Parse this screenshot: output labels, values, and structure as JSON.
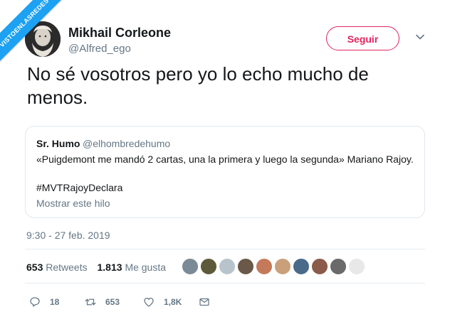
{
  "watermark": "VISTOENLASREDES",
  "author": {
    "name": "Mikhail Corleone",
    "handle": "@Alfred_ego"
  },
  "follow_label": "Seguir",
  "tweet_text": "No sé vosotros pero yo lo echo mucho de menos.",
  "quoted": {
    "name": "Sr. Humo",
    "handle": "@elhombredehumo",
    "text": "«Puigdemont me mandó 2 cartas, una la primera y luego la segunda» Mariano Rajoy.",
    "hashtag": "#MVTRajoyDeclara",
    "thread_link": "Mostrar este hilo"
  },
  "timestamp": "9:30 - 27 feb. 2019",
  "stats": {
    "retweets_count": "653",
    "retweets_label": "Retweets",
    "likes_count": "1.813",
    "likes_label": "Me gusta"
  },
  "likers_colors": [
    "#7a8a96",
    "#5d5a3a",
    "#b8c4cc",
    "#6a5848",
    "#c47a5a",
    "#c9a07a",
    "#4a6a8a",
    "#8a5a4a",
    "#6a6a6a",
    "#e8e8e8"
  ],
  "actions": {
    "replies": "18",
    "retweets": "653",
    "likes": "1,8K"
  },
  "colors": {
    "follow_accent": "#e0245e",
    "watermark_bg": "#1da1f2"
  }
}
